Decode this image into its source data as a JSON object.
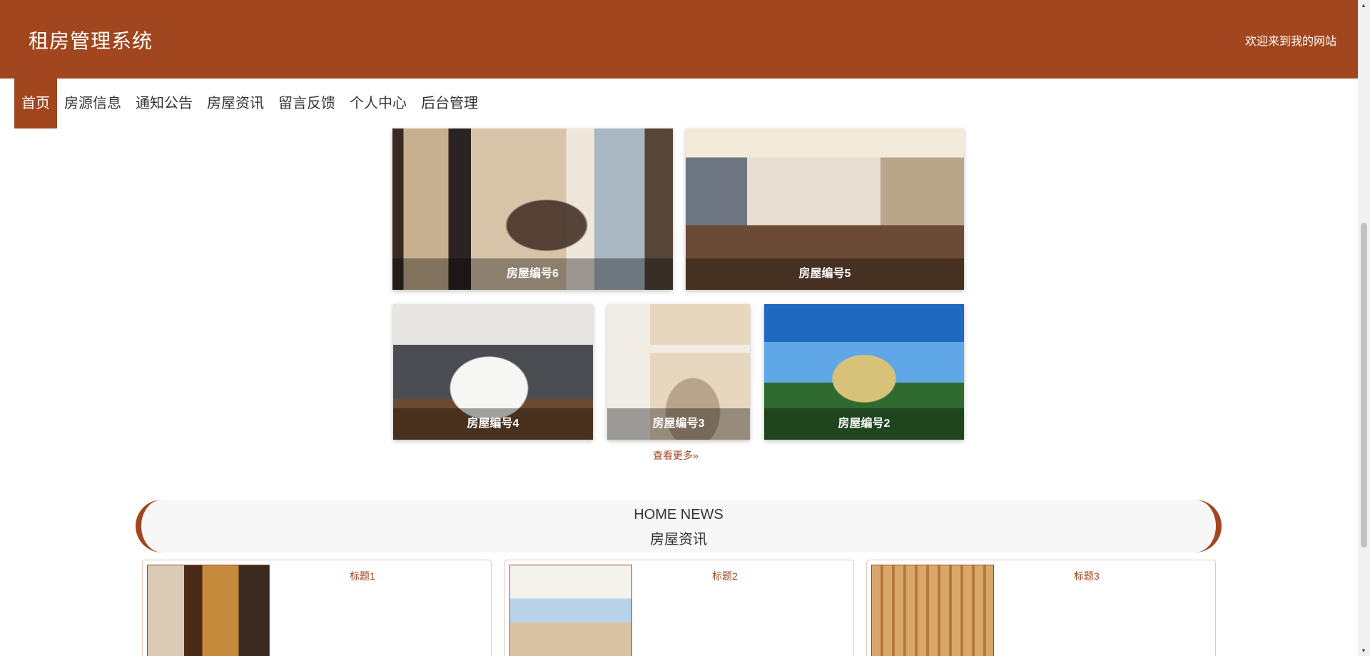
{
  "header": {
    "site_title": "租房管理系统",
    "welcome": "欢迎来到我的网站"
  },
  "nav": {
    "items": [
      {
        "label": "首页"
      },
      {
        "label": "房源信息"
      },
      {
        "label": "通知公告"
      },
      {
        "label": "房屋资讯"
      },
      {
        "label": "留言反馈"
      },
      {
        "label": "个人中心"
      },
      {
        "label": "后台管理"
      }
    ],
    "active": "首页"
  },
  "houses": [
    {
      "caption": "房屋编号6"
    },
    {
      "caption": "房屋编号5"
    },
    {
      "caption": "房屋编号4"
    },
    {
      "caption": "房屋编号3"
    },
    {
      "caption": "房屋编号2"
    }
  ],
  "more_link": "查看更多",
  "news_section": {
    "title_en": "HOME NEWS",
    "title_cn": "房屋资讯",
    "items": [
      {
        "title": "标题1"
      },
      {
        "title": "标题2"
      },
      {
        "title": "标题3"
      }
    ]
  },
  "colors": {
    "brand": "#a1461e",
    "news_bg": "#f7f7f7"
  }
}
